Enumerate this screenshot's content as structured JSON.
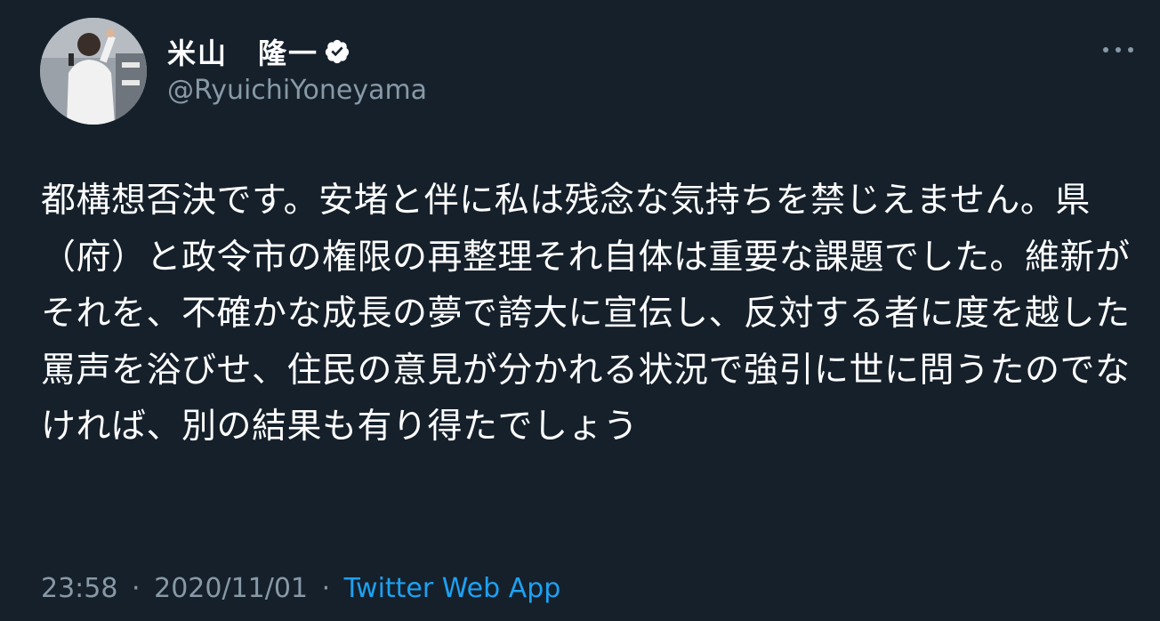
{
  "author": {
    "display_name": "米山　隆一",
    "handle": "@RyuichiYoneyama",
    "verified": true
  },
  "tweet": {
    "text": "都構想否決です。安堵と伴に私は残念な気持ちを禁じえません。県（府）と政令市の権限の再整理それ自体は重要な課題でした。維新がそれを、不確かな成長の夢で誇大に宣伝し、反対する者に度を越した罵声を浴びせ、住民の意見が分かれる状況で強引に世に問うたのでなければ、別の結果も有り得たでしょう",
    "time": "23:58",
    "separator": "·",
    "date": "2020/11/01",
    "source": "Twitter Web App"
  },
  "icons": {
    "verified": "verified-badge-icon",
    "more": "more-options-icon"
  },
  "colors": {
    "background": "#15202b",
    "text": "#ffffff",
    "secondary": "#8899a6",
    "accent": "#1da1f2"
  }
}
